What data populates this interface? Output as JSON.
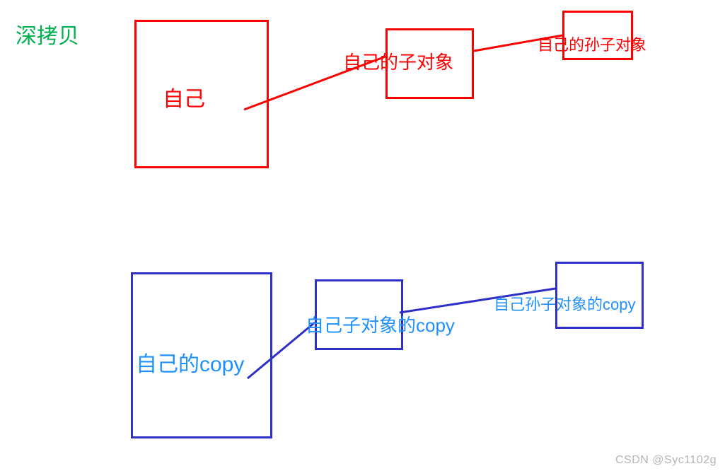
{
  "title": "深拷贝",
  "colors": {
    "title": "#00b050",
    "red_border": "#ff0000",
    "red_text": "#ff0000",
    "blue_border": "#2e2ec9",
    "blue_text": "#1e90ff"
  },
  "top": {
    "self": "自己",
    "child": "自己的子对象",
    "grandchild": "自己的孙子对象"
  },
  "bottom": {
    "self": "自己的copy",
    "child": "自己子对象的copy",
    "grandchild": "自己孙子对象的copy"
  },
  "watermark": "CSDN @Syc1102g"
}
